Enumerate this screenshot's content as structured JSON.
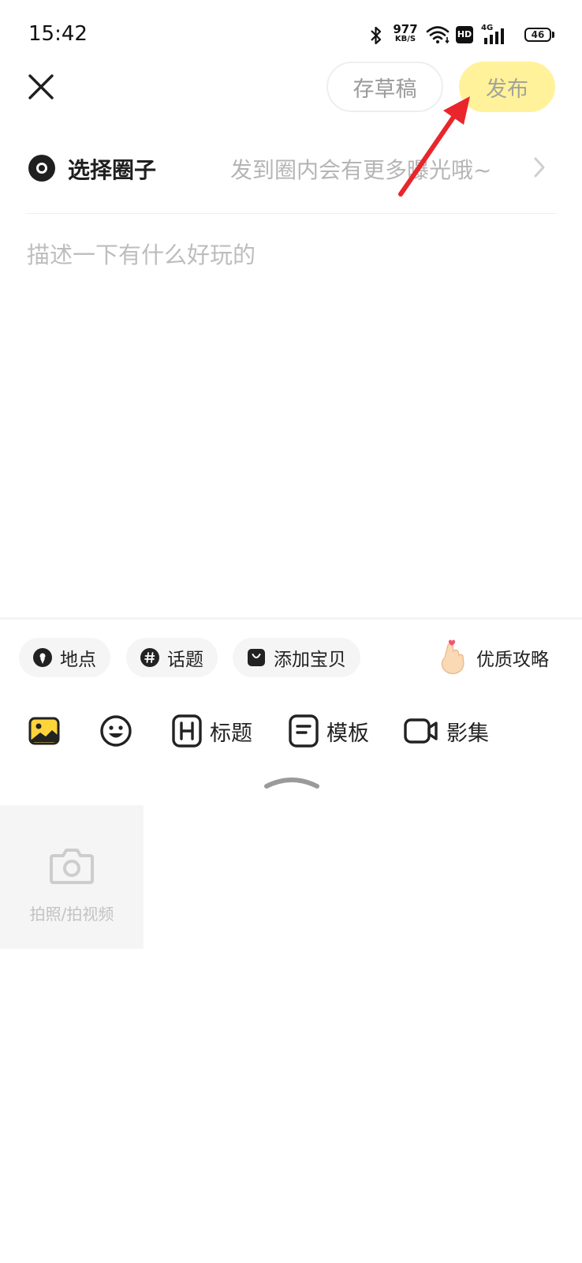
{
  "status_bar": {
    "time": "15:42",
    "net_speed": "977",
    "net_unit": "KB/S",
    "hd": "HD",
    "network": "4G",
    "battery": "46"
  },
  "header": {
    "close_icon": "close-icon",
    "draft_label": "存草稿",
    "publish_label": "发布",
    "publish_color": "#fff29a"
  },
  "circle": {
    "label": "选择圈子",
    "hint": "发到圈内会有更多曝光哦~"
  },
  "editor": {
    "placeholder": "描述一下有什么好玩的"
  },
  "chips": {
    "location": "地点",
    "topic": "话题",
    "product": "添加宝贝",
    "guide": "优质攻略"
  },
  "toolbar": {
    "heading": "标题",
    "template": "模板",
    "album": "影集"
  },
  "media": {
    "camera_label": "拍照/拍视频"
  },
  "annotation": {
    "arrow_color": "#e8262b"
  }
}
